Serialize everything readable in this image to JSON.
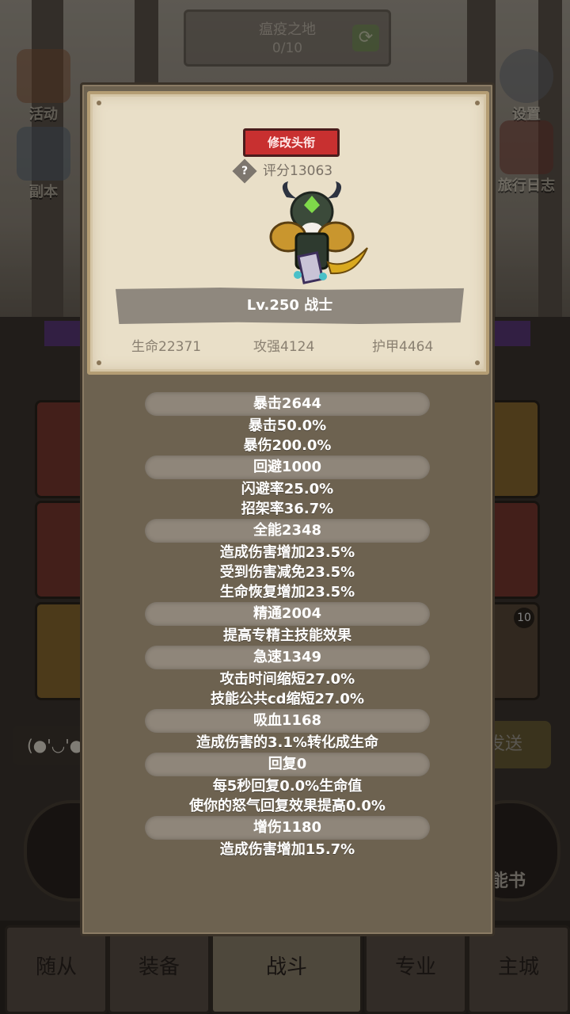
{
  "background": {
    "zone_title": "瘟疫之地",
    "zone_progress": "0/10",
    "left_buttons": [
      "活动",
      "副本"
    ],
    "right_buttons": [
      "设置",
      "旅行日志"
    ],
    "chat_emote": "(●'◡'●",
    "send_label": "发送",
    "skillbook_label": "能书",
    "card_badge": "10",
    "tabs": [
      "随从",
      "装备",
      "战斗",
      "专业",
      "主城"
    ]
  },
  "modal": {
    "rename_button": "修改头衔",
    "score": "评分13063",
    "level_class": "Lv.250 战士",
    "stats": {
      "hp": "生命22371",
      "attack": "攻强4124",
      "armor": "护甲4464"
    },
    "attributes": [
      {
        "head": "暴击2644",
        "lines": [
          "暴击50.0%",
          "暴伤200.0%"
        ]
      },
      {
        "head": "回避1000",
        "lines": [
          "闪避率25.0%",
          "招架率36.7%"
        ]
      },
      {
        "head": "全能2348",
        "lines": [
          "造成伤害增加23.5%",
          "受到伤害减免23.5%",
          "生命恢复增加23.5%"
        ]
      },
      {
        "head": "精通2004",
        "lines": [
          "提高专精主技能效果"
        ]
      },
      {
        "head": "急速1349",
        "lines": [
          "攻击时间缩短27.0%",
          "技能公共cd缩短27.0%"
        ]
      },
      {
        "head": "吸血1168",
        "lines": [
          "造成伤害的3.1%转化成生命"
        ]
      },
      {
        "head": "回复0",
        "lines": [
          "每5秒回复0.0%生命值",
          "使你的怒气回复效果提高0.0%"
        ]
      },
      {
        "head": "增伤1180",
        "lines": [
          "造成伤害增加15.7%"
        ]
      }
    ]
  },
  "colors": {
    "rename_red": "#c83030",
    "card_parchment": "#e9dfc8",
    "panel_brown": "#6d6250"
  }
}
